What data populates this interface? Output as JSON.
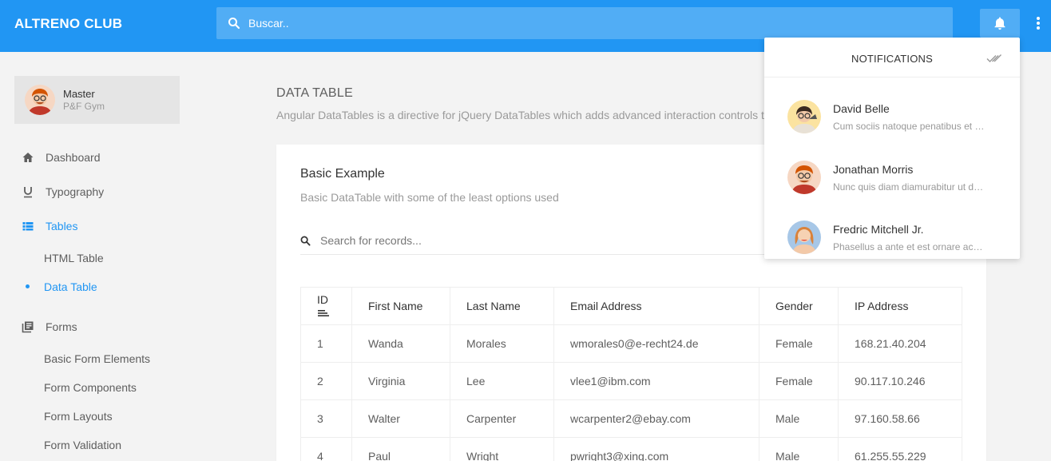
{
  "header": {
    "brand": "ALTRENO CLUB",
    "search_placeholder": "Buscar..",
    "accent_color": "#2196f3"
  },
  "profile": {
    "name": "Master",
    "subtitle": "P&F Gym"
  },
  "sidebar": {
    "items": [
      {
        "label": "Dashboard",
        "icon": "home-icon"
      },
      {
        "label": "Typography",
        "icon": "underline-icon"
      },
      {
        "label": "Tables",
        "icon": "table-icon",
        "active": true
      },
      {
        "label": "Forms",
        "icon": "forms-icon"
      }
    ],
    "tables_sub": [
      {
        "label": "HTML Table"
      },
      {
        "label": "Data Table",
        "active": true
      }
    ],
    "forms_sub": [
      {
        "label": "Basic Form Elements"
      },
      {
        "label": "Form Components"
      },
      {
        "label": "Form Layouts"
      },
      {
        "label": "Form Validation"
      }
    ]
  },
  "page": {
    "title": "DATA TABLE",
    "description": "Angular DataTables is a directive for jQuery DataTables which adds advanced interaction controls to y"
  },
  "card": {
    "title": "Basic Example",
    "description": "Basic DataTable with some of the least options used",
    "search_placeholder": "Search for records..."
  },
  "table": {
    "headers": [
      "ID",
      "First Name",
      "Last Name",
      "Email Address",
      "Gender",
      "IP Address"
    ],
    "rows": [
      [
        "1",
        "Wanda",
        "Morales",
        "wmorales0@e-recht24.de",
        "Female",
        "168.21.40.204"
      ],
      [
        "2",
        "Virginia",
        "Lee",
        "vlee1@ibm.com",
        "Female",
        "90.117.10.246"
      ],
      [
        "3",
        "Walter",
        "Carpenter",
        "wcarpenter2@ebay.com",
        "Male",
        "97.160.58.66"
      ],
      [
        "4",
        "Paul",
        "Wright",
        "pwright3@xing.com",
        "Male",
        "61.255.55.229"
      ]
    ]
  },
  "notifications": {
    "title": "NOTIFICATIONS",
    "items": [
      {
        "name": "David Belle",
        "message": "Cum sociis natoque penatibus et magnis dis parturient"
      },
      {
        "name": "Jonathan Morris",
        "message": "Nunc quis diam diamurabitur ut dui velit"
      },
      {
        "name": "Fredric Mitchell Jr.",
        "message": "Phasellus a ante et est ornare accumsan"
      }
    ]
  }
}
